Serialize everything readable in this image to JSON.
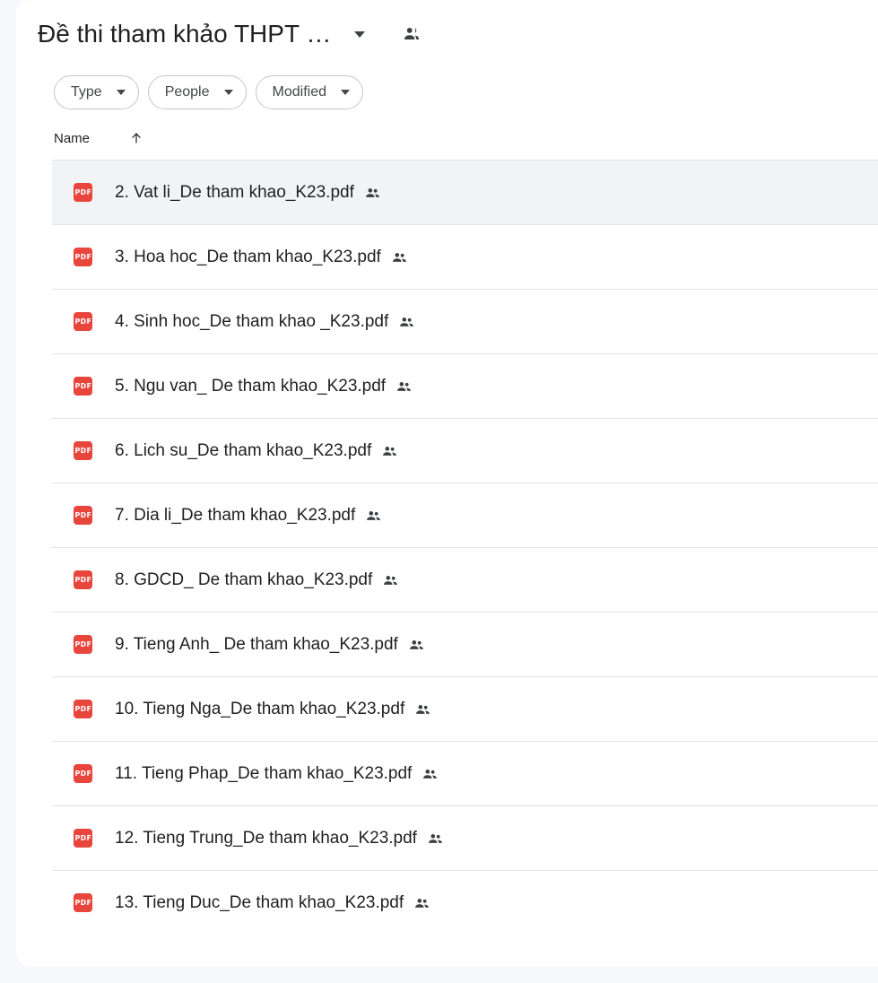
{
  "header": {
    "folder_title": "Đề thi tham khảo THPT …",
    "caret_icon": "chevron-down-icon",
    "shared_icon": "shared-people-icon"
  },
  "filters": [
    {
      "label": "Type",
      "icon": "chevron-down-icon"
    },
    {
      "label": "People",
      "icon": "chevron-down-icon"
    },
    {
      "label": "Modified",
      "icon": "chevron-down-icon"
    }
  ],
  "list_header": {
    "name_column": "Name",
    "sort_icon": "arrow-up-icon",
    "sort_direction": "ascending"
  },
  "colors": {
    "page_background": "#f6f8fc",
    "card_background": "#ffffff",
    "pdf_badge": "#e8453c",
    "selected_row": "#f1f3f4",
    "divider": "#e3e3e3",
    "text_primary": "#1f1f1f",
    "chip_border": "#c4c7c5"
  },
  "files": [
    {
      "name": "2. Vat li_De tham khao_K23.pdf",
      "type": "PDF",
      "shared": true,
      "selected": true
    },
    {
      "name": "3. Hoa hoc_De tham khao_K23.pdf",
      "type": "PDF",
      "shared": true,
      "selected": false
    },
    {
      "name": "4. Sinh hoc_De tham khao _K23.pdf",
      "type": "PDF",
      "shared": true,
      "selected": false
    },
    {
      "name": "5. Ngu van_ De tham khao_K23.pdf",
      "type": "PDF",
      "shared": true,
      "selected": false
    },
    {
      "name": "6. Lich su_De tham khao_K23.pdf",
      "type": "PDF",
      "shared": true,
      "selected": false
    },
    {
      "name": "7. Dia li_De tham khao_K23.pdf",
      "type": "PDF",
      "shared": true,
      "selected": false
    },
    {
      "name": "8. GDCD_ De tham khao_K23.pdf",
      "type": "PDF",
      "shared": true,
      "selected": false
    },
    {
      "name": "9. Tieng Anh_ De tham khao_K23.pdf",
      "type": "PDF",
      "shared": true,
      "selected": false
    },
    {
      "name": "10. Tieng Nga_De tham khao_K23.pdf",
      "type": "PDF",
      "shared": true,
      "selected": false
    },
    {
      "name": "11. Tieng Phap_De tham khao_K23.pdf",
      "type": "PDF",
      "shared": true,
      "selected": false
    },
    {
      "name": "12. Tieng Trung_De tham khao_K23.pdf",
      "type": "PDF",
      "shared": true,
      "selected": false
    },
    {
      "name": "13. Tieng Duc_De tham khao_K23.pdf",
      "type": "PDF",
      "shared": true,
      "selected": false
    }
  ],
  "pdf_badge_label": "PDF"
}
